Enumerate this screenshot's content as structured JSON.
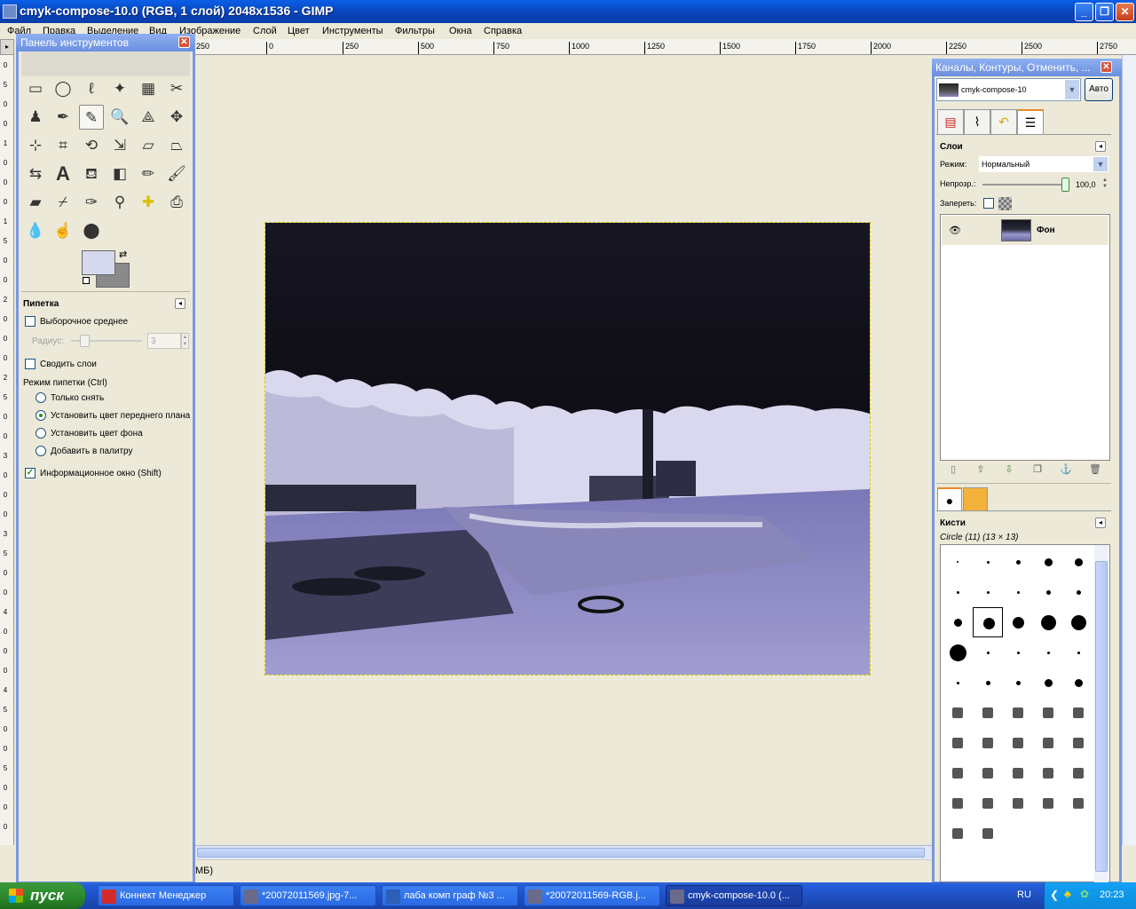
{
  "window": {
    "title": "cmyk-compose-10.0 (RGB, 1 слой) 2048x1536 - GIMP"
  },
  "menu": {
    "items": [
      "Файл",
      "Правка",
      "Выделение",
      "Вид",
      "Изображение",
      "Слой",
      "Цвет",
      "Инструменты",
      "Фильтры",
      "Окна",
      "Справка"
    ]
  },
  "ruler": {
    "h_ticks": [
      "250",
      "0",
      "250",
      "500",
      "750",
      "1000",
      "1250",
      "1500",
      "1750",
      "2000",
      "2250",
      "2500",
      "2750"
    ],
    "v_ticks": [
      "0",
      "5",
      "0",
      "0",
      "1",
      "0",
      "0",
      "0",
      "1",
      "5",
      "0",
      "0",
      "2",
      "0",
      "0",
      "0",
      "2",
      "5",
      "0",
      "0",
      "3",
      "0",
      "0",
      "0",
      "3",
      "5",
      "0",
      "0",
      "4",
      "0",
      "0",
      "0",
      "4",
      "5",
      "0",
      "0",
      "5",
      "0",
      "0",
      "0"
    ]
  },
  "status": {
    "text": "МБ)"
  },
  "toolbox": {
    "title": "Панель инструментов",
    "tool_options_title": "Пипетка",
    "sample_average_label": "Выборочное среднее",
    "radius_label": "Радиус:",
    "radius_value": "3",
    "sample_merged_label": "Сводить слои",
    "pick_mode_label": "Режим пипетки  (Ctrl)",
    "pick_modes": [
      "Только снять",
      "Установить цвет переднего плана",
      "Установить цвет фона",
      "Добавить в палитру"
    ],
    "selected_pick_mode": 1,
    "info_window_label": "Информационное окно  (Shift)",
    "info_window_checked": true,
    "fg_color": "#d5d9ee",
    "bg_color": "#8a8a8a"
  },
  "dock": {
    "title": "Каналы, Контуры, Отменить, ...",
    "image_name": "cmyk-compose-10",
    "auto_label": "Авто",
    "layers_title": "Слои",
    "mode_label": "Режим:",
    "mode_value": "Нормальный",
    "opacity_label": "Непрозр.:",
    "opacity_value": "100,0",
    "lock_label": "Запереть:",
    "layer_name": "Фон",
    "brushes_title": "Кисти",
    "brush_selected": "Circle (11) (13 × 13)"
  },
  "taskbar": {
    "start_label": "пуск",
    "buttons": [
      {
        "label": "Коннект Менеджер",
        "icon_color": "#d42a2a"
      },
      {
        "label": "*20072011569.jpg-7...",
        "icon_color": "#6a6a8a"
      },
      {
        "label": "лаба комп граф №3 ...",
        "icon_color": "#2b5fb8"
      },
      {
        "label": "*20072011569-RGB.j...",
        "icon_color": "#6a6a8a"
      },
      {
        "label": "cmyk-compose-10.0 (...",
        "icon_color": "#6a6a8a"
      }
    ],
    "active_index": 4,
    "lang": "RU",
    "clock": "20:23"
  },
  "colors": {
    "title_blue": "#0842b4",
    "dock_title": "#6b8fe0",
    "canvas_bg": "#ece9d8"
  }
}
